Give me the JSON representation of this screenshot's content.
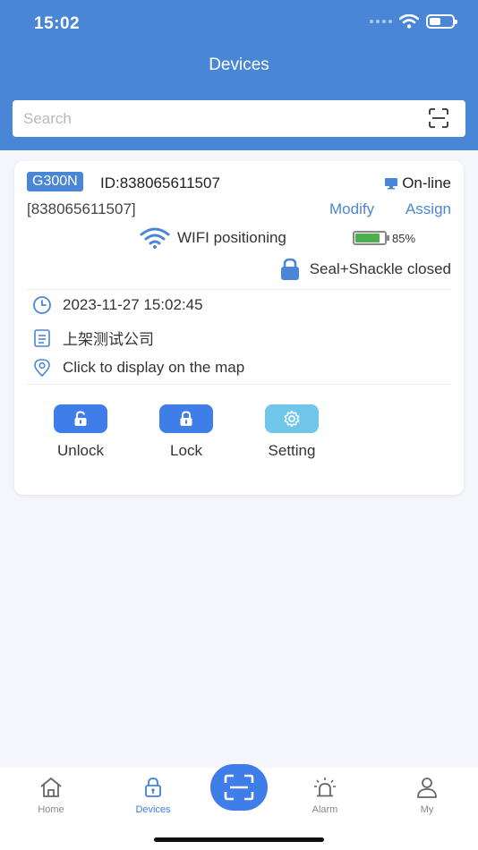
{
  "status_bar": {
    "time": "15:02"
  },
  "header": {
    "title": "Devices"
  },
  "search": {
    "placeholder": "Search",
    "value": ""
  },
  "device": {
    "model": "G300N",
    "id_label": "ID:838065611507",
    "status": "On-line",
    "imei_label": "[838065611507]",
    "modify_label": "Modify",
    "assign_label": "Assign",
    "positioning": "WIFI positioning",
    "battery_percent": "85%",
    "battery_level": 0.85,
    "seal_status": "Seal+Shackle closed",
    "timestamp": "2023-11-27 15:02:45",
    "company": "上架测试公司",
    "map_hint": "Click to display on the map"
  },
  "actions": [
    {
      "label": "Unlock",
      "icon": "unlock-icon"
    },
    {
      "label": "Lock",
      "icon": "lock-icon"
    },
    {
      "label": "Setting",
      "icon": "gear-icon"
    }
  ],
  "tabs": [
    {
      "label": "Home",
      "icon": "home-icon"
    },
    {
      "label": "Devices",
      "icon": "lock-icon",
      "active": true
    },
    {
      "label": "Alarm",
      "icon": "alarm-icon"
    },
    {
      "label": "My",
      "icon": "user-icon"
    }
  ],
  "colors": {
    "primary": "#4a86d6",
    "button_blue": "#3f7ee8",
    "button_teal": "#6fc6e8",
    "battery_green": "#4caf50",
    "background": "#f4f6fb"
  }
}
